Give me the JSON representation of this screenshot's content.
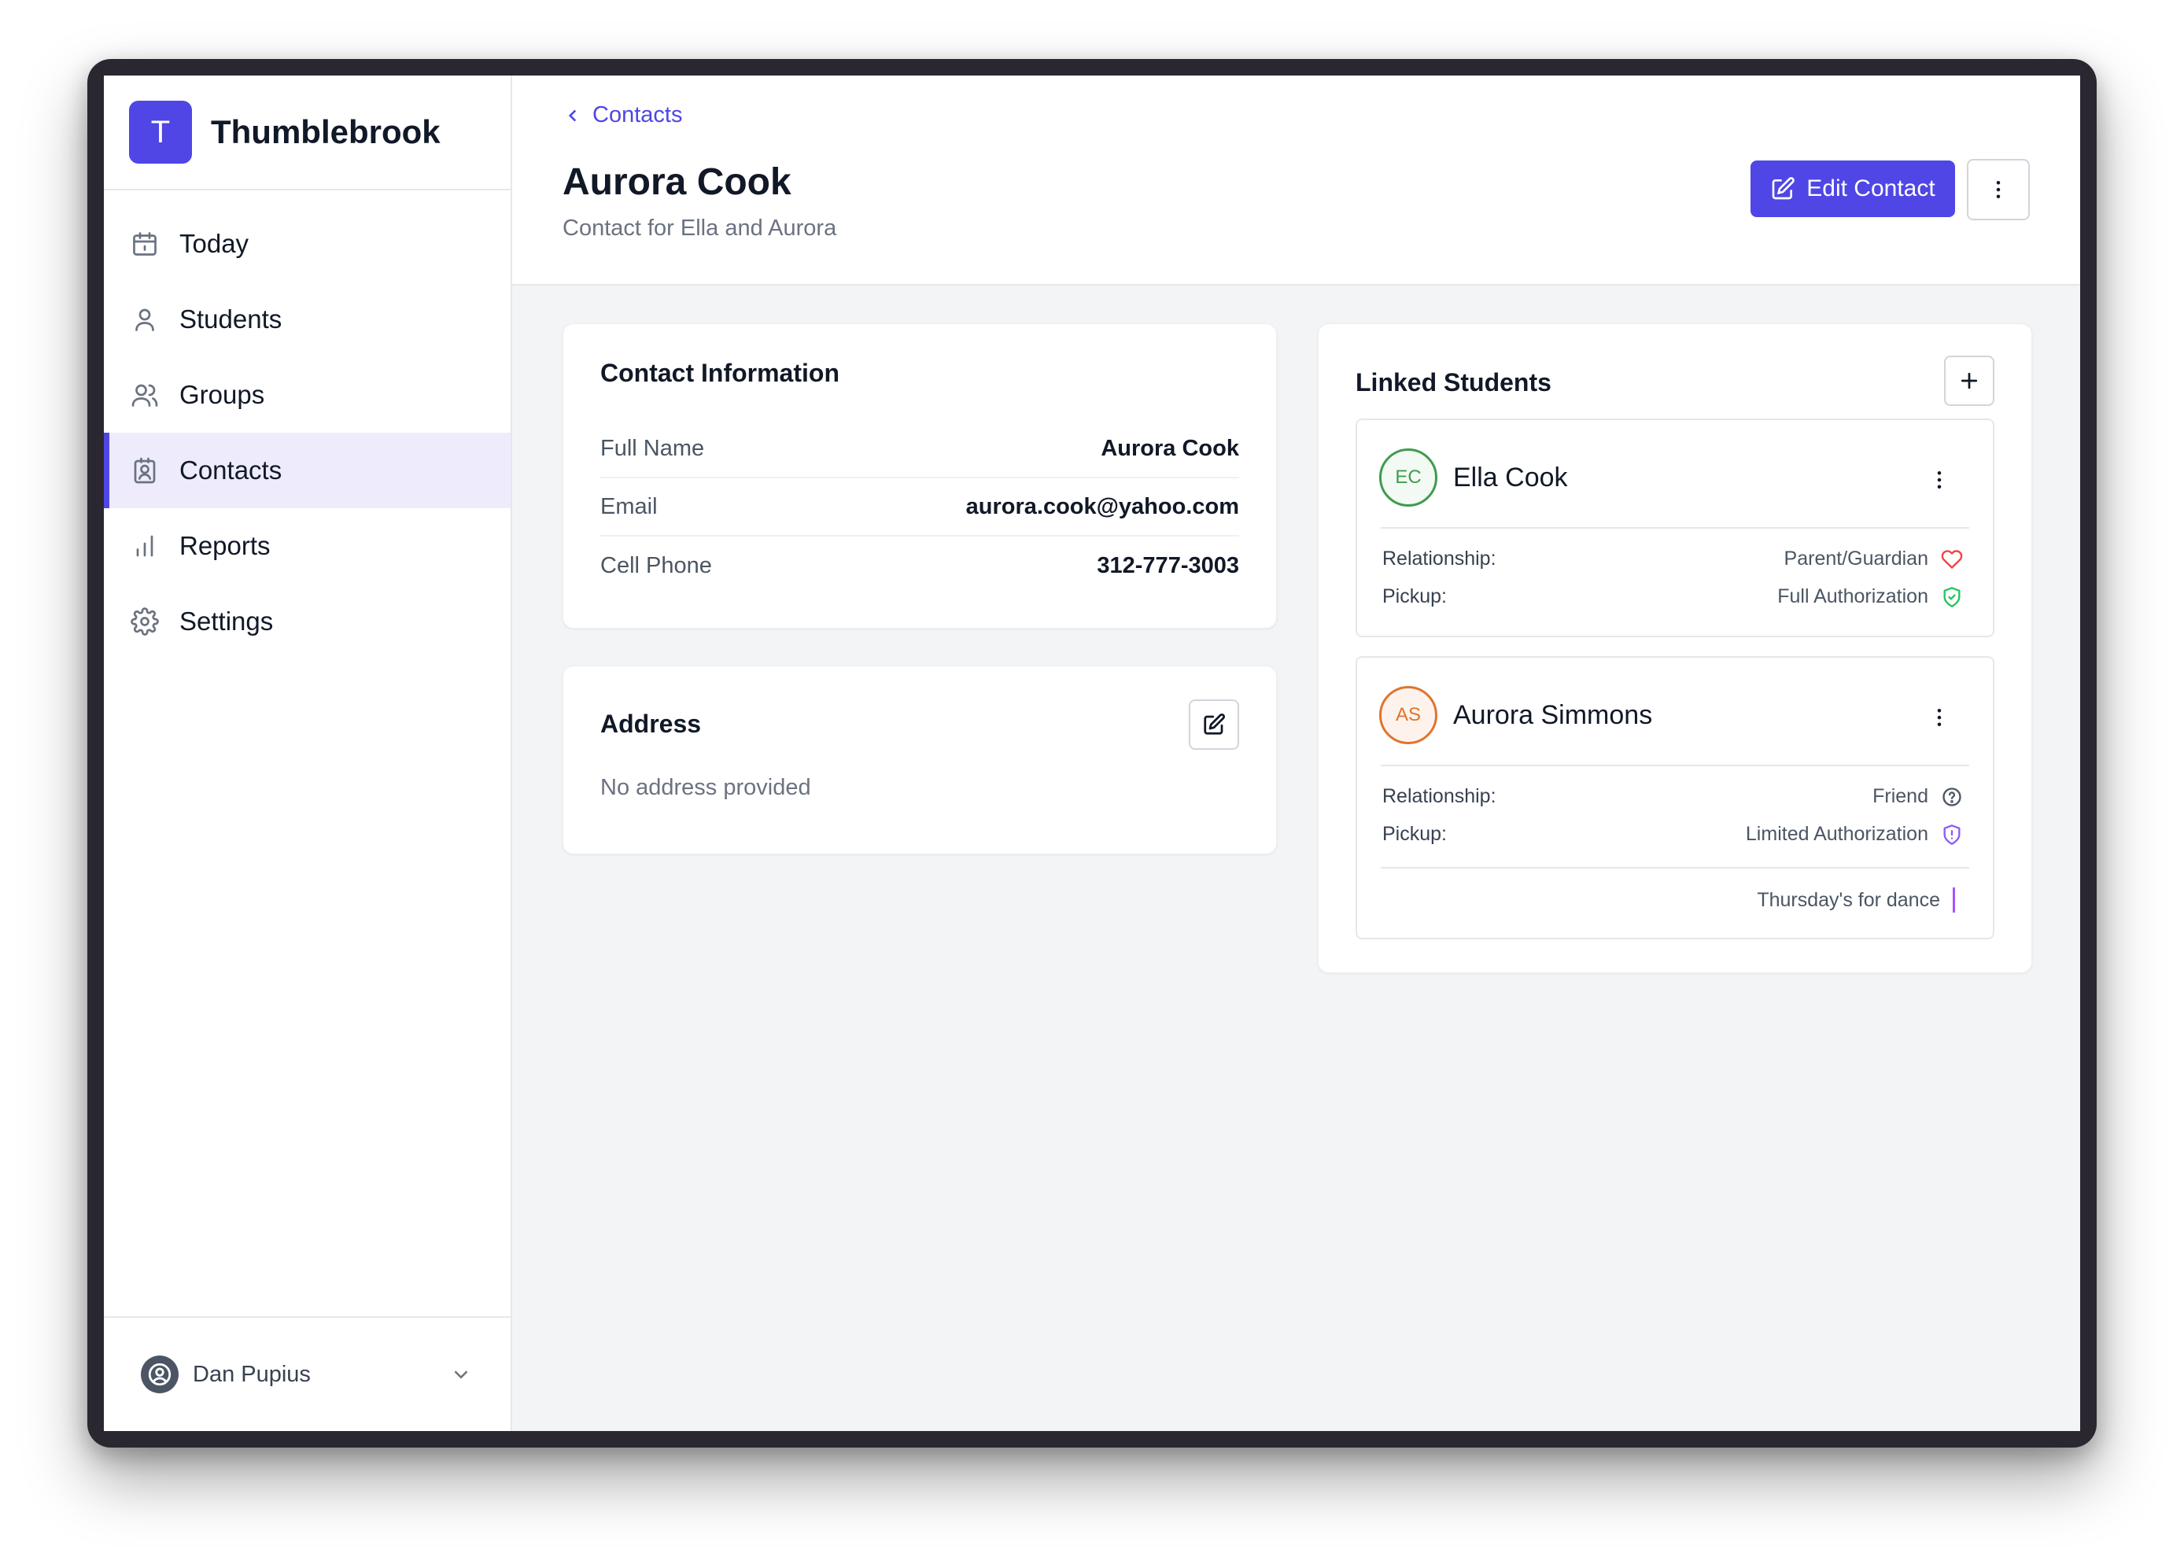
{
  "brand": {
    "initial": "T",
    "name": "Thumblebrook",
    "color": "#4f46e5"
  },
  "sidebar": {
    "items": [
      {
        "label": "Today",
        "icon": "calendar-icon",
        "active": false
      },
      {
        "label": "Students",
        "icon": "user-icon",
        "active": false
      },
      {
        "label": "Groups",
        "icon": "users-icon",
        "active": false
      },
      {
        "label": "Contacts",
        "icon": "contact-card-icon",
        "active": true
      },
      {
        "label": "Reports",
        "icon": "bar-chart-icon",
        "active": false
      },
      {
        "label": "Settings",
        "icon": "gear-icon",
        "active": false
      }
    ],
    "user": {
      "name": "Dan Pupius"
    }
  },
  "header": {
    "breadcrumb": "Contacts",
    "title": "Aurora Cook",
    "subtitle": "Contact for Ella and Aurora",
    "edit_label": "Edit Contact"
  },
  "contact_info": {
    "title": "Contact Information",
    "rows": [
      {
        "label": "Full Name",
        "value": "Aurora Cook"
      },
      {
        "label": "Email",
        "value": "aurora.cook@yahoo.com"
      },
      {
        "label": "Cell Phone",
        "value": "312-777-3003"
      }
    ]
  },
  "address": {
    "title": "Address",
    "empty_text": "No address provided"
  },
  "linked_students": {
    "title": "Linked Students",
    "students": [
      {
        "initials": "EC",
        "name": "Ella Cook",
        "relationship_label": "Relationship:",
        "relationship": "Parent/Guardian",
        "relationship_icon": "heart-icon",
        "pickup_label": "Pickup:",
        "pickup": "Full Authorization",
        "pickup_icon": "shield-check-icon"
      },
      {
        "initials": "AS",
        "name": "Aurora Simmons",
        "relationship_label": "Relationship:",
        "relationship": "Friend",
        "relationship_icon": "help-circle-icon",
        "pickup_label": "Pickup:",
        "pickup": "Limited Authorization",
        "pickup_icon": "shield-alert-icon",
        "note": "Thursday's for dance"
      }
    ]
  },
  "colors": {
    "accent": "#4f46e5",
    "heart": "#ef4444",
    "shield_full": "#22c55e",
    "shield_limited": "#8b5cf6",
    "note_bar": "#a855f7"
  }
}
